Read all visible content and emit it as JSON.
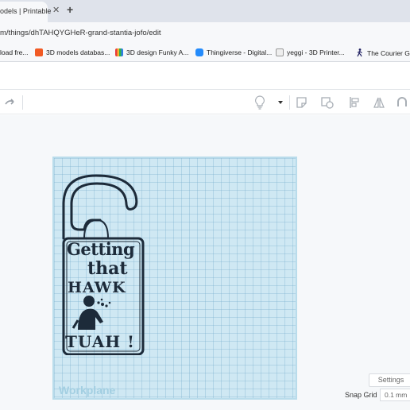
{
  "browser": {
    "tab_title": "odels | Printable",
    "tab_close": "✕",
    "new_tab": "+",
    "url": "m/things/dhTAHQYGHeR-grand-stantia-jofo/edit"
  },
  "bookmarks": [
    {
      "label": "load fre...",
      "icon": "bookmark-icon",
      "color": "#777777"
    },
    {
      "label": "3D models databas...",
      "icon": "cults-icon",
      "color": "#f15a24"
    },
    {
      "label": "3D design Funky A...",
      "icon": "tinkercad-icon",
      "color": "#e93b3b"
    },
    {
      "label": "Thingiverse - Digital...",
      "icon": "thingiverse-icon",
      "color": "#248bfb"
    },
    {
      "label": "yeggi - 3D Printer...",
      "icon": "yeggi-icon",
      "color": "#555555"
    },
    {
      "label": "The Courier Gu",
      "icon": "walker-icon",
      "color": "#1a1a5e"
    }
  ],
  "workplane": {
    "label": "Workplane"
  },
  "model": {
    "line1": "Getting",
    "line2": "that",
    "line3": "HAWK",
    "line4": "TUAH !"
  },
  "controls": {
    "settings_label": "Settings",
    "snap_grid_label": "Snap Grid",
    "snap_grid_value": "0.1 mm"
  },
  "colors": {
    "workplane": "#cfe8f3",
    "model_outline": "#1d2b3a"
  }
}
